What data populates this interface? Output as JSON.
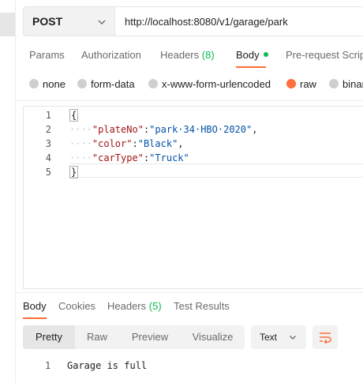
{
  "request": {
    "method": "POST",
    "url": "http://localhost:8080/v1/garage/park"
  },
  "request_tabs": [
    {
      "label": "Params"
    },
    {
      "label": "Authorization"
    },
    {
      "label": "Headers",
      "count": "(8)"
    },
    {
      "label": "Body",
      "active": true
    },
    {
      "label": "Pre-request Scrip"
    }
  ],
  "body_types": [
    {
      "label": "none"
    },
    {
      "label": "form-data"
    },
    {
      "label": "x-www-form-urlencoded"
    },
    {
      "label": "raw",
      "selected": true
    },
    {
      "label": "binar"
    }
  ],
  "editor": {
    "line_numbers": [
      "1",
      "2",
      "3",
      "4",
      "5"
    ],
    "open_brace": "{",
    "close_brace": "}",
    "ws_indent": "····",
    "fields": [
      {
        "key": "\"plateNo\"",
        "colon": ":",
        "value": "\"park·34·HBO·2020\"",
        "comma": ","
      },
      {
        "key": "\"color\"",
        "colon": ":",
        "value": "\"Black\"",
        "comma": ","
      },
      {
        "key": "\"carType\"",
        "colon": ":",
        "value": "\"Truck\"",
        "comma": ""
      }
    ]
  },
  "response_tabs": [
    {
      "label": "Body",
      "active": true
    },
    {
      "label": "Cookies"
    },
    {
      "label": "Headers",
      "count": "(5)"
    },
    {
      "label": "Test Results"
    }
  ],
  "view_modes": [
    {
      "label": "Pretty",
      "active": true
    },
    {
      "label": "Raw"
    },
    {
      "label": "Preview"
    },
    {
      "label": "Visualize"
    }
  ],
  "format": {
    "selected": "Text"
  },
  "response": {
    "line_number": "1",
    "text": "Garage is full"
  },
  "colors": {
    "accent": "#ff6c37",
    "count_green": "#0cbb52"
  },
  "icons": {
    "method_dropdown": "chevron-down-icon",
    "format_dropdown": "chevron-down-icon",
    "wrap": "wrap-lines-icon"
  }
}
